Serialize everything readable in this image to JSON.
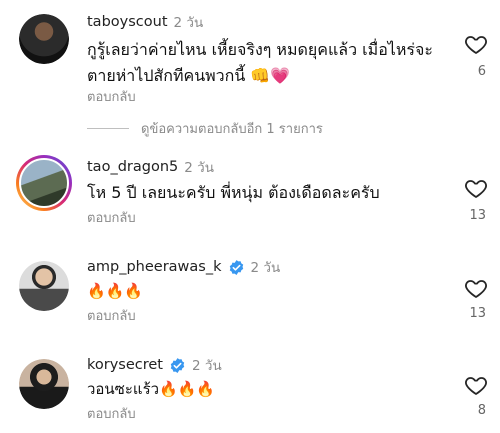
{
  "comments": [
    {
      "username": "taboyscout",
      "time": "2 วัน",
      "text": "กูรู้เลยว่าค่ายไหน เหี้ยจริงๆ หมดยุคแล้ว เมื่อไหร่จะตายห่าไปสักทีคนพวกนี้ 👊💗",
      "reply_label": "ตอบกลับ",
      "likes": "6",
      "verified": false
    },
    {
      "username": "tao_dragon5",
      "time": "2 วัน",
      "text": "โห 5 ปี เลยนะครับ พี่หนุ่ม ต้องเดือดละครับ",
      "reply_label": "ตอบกลับ",
      "likes": "13",
      "verified": false
    },
    {
      "username": "amp_pheerawas_k",
      "time": "2 วัน",
      "text": "🔥🔥🔥",
      "reply_label": "ตอบกลับ",
      "likes": "13",
      "verified": true
    },
    {
      "username": "korysecret",
      "time": "2 วัน",
      "text": "วอนซะแร้ว🔥🔥🔥",
      "reply_label": "ตอบกลับ",
      "likes": "8",
      "verified": true
    }
  ],
  "more_replies_label": "ดูข้อความตอบกลับอีก 1 รายการ",
  "icons": {
    "like": "heart-outline-icon",
    "verified": "verified-badge-icon"
  },
  "colors": {
    "verified": "#3897f0",
    "muted_text": "#8a8a8a"
  }
}
